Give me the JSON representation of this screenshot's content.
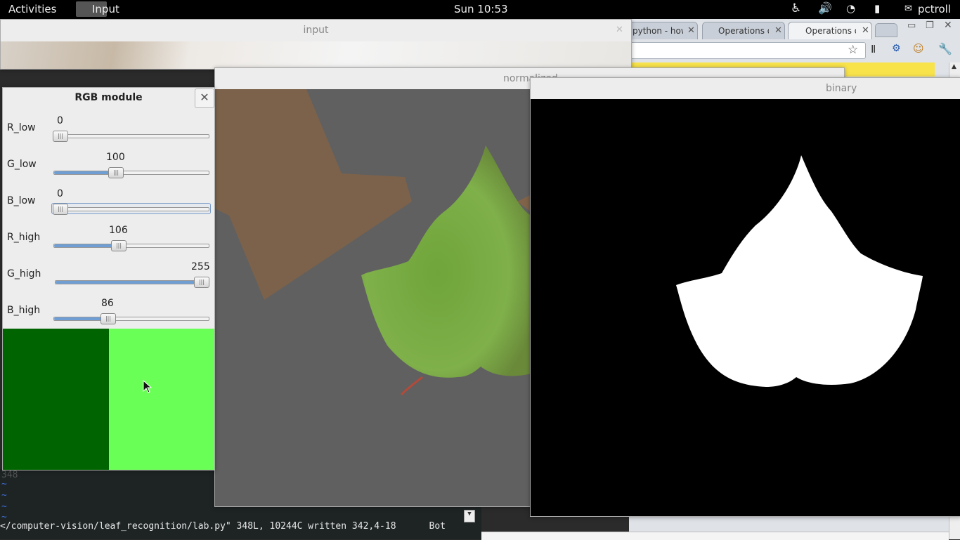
{
  "topbar": {
    "activities": "Activities",
    "app_name": "Input",
    "clock": "Sun 10:53",
    "user": "pctroll"
  },
  "browser": {
    "tabs": [
      {
        "label": "python - how"
      },
      {
        "label": "Operations o"
      },
      {
        "label": "Operations o",
        "active": true
      }
    ]
  },
  "terminal": {
    "status_file": "</computer-vision/leaf_recognition/lab.py\" 348L, 10244C written",
    "status_pos": "342,4-18",
    "status_scroll": "Bot",
    "line_number": "348"
  },
  "windows": {
    "input_title": "input",
    "normalized_title": "normalized",
    "binary_title": "binary",
    "rgb_title": "RGB module"
  },
  "sliders": [
    {
      "label": "R_low",
      "value": "0",
      "fraction": 0.0
    },
    {
      "label": "G_low",
      "value": "100",
      "fraction": 0.392
    },
    {
      "label": "B_low",
      "value": "0",
      "fraction": 0.0,
      "focused": true
    },
    {
      "label": "R_high",
      "value": "106",
      "fraction": 0.416
    },
    {
      "label": "G_high",
      "value": "255",
      "fraction": 1.0
    },
    {
      "label": "B_high",
      "value": "86",
      "fraction": 0.337
    }
  ],
  "colors": {
    "low_swatch": "#006400",
    "high_swatch": "#6aff56",
    "slider_fill": "#6e9ed4"
  }
}
